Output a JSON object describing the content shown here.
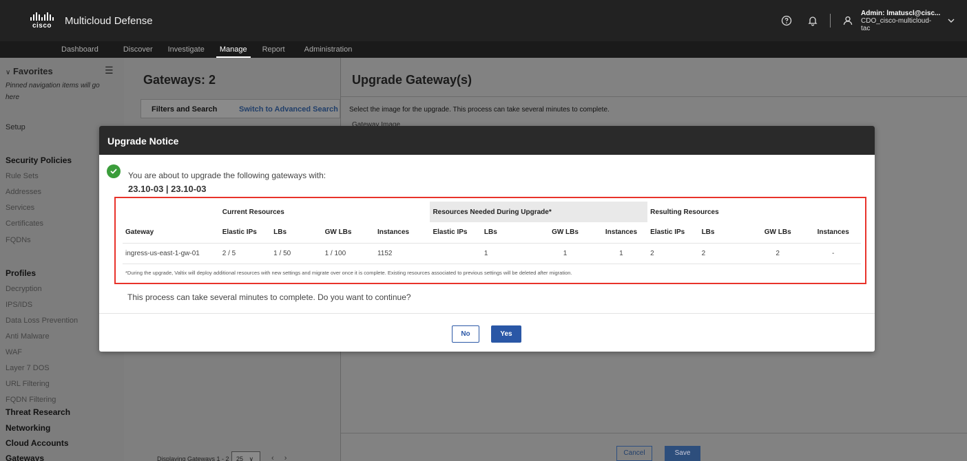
{
  "app": {
    "logo_text": "cisco",
    "title": "Multicloud Defense"
  },
  "user": {
    "line1": "Admin: lmatuscl@cisc...",
    "line2": "CDO_cisco-multicloud-",
    "line3": "tac"
  },
  "nav": {
    "items": [
      "Dashboard",
      "Discover",
      "Investigate",
      "Manage",
      "Report",
      "Administration"
    ],
    "active": "Manage"
  },
  "sidebar": {
    "favorites_label": "Favorites",
    "favorites_sub": "Pinned navigation items will go here",
    "setup": "Setup",
    "security_policies": "Security Policies",
    "policy_items": [
      "Rule Sets",
      "Addresses",
      "Services",
      "Certificates",
      "FQDNs"
    ],
    "profiles": "Profiles",
    "profile_items": [
      "Decryption",
      "IPS/IDS",
      "Data Loss Prevention",
      "Anti Malware",
      "WAF",
      "Layer 7 DOS",
      "URL Filtering",
      "FQDN Filtering"
    ],
    "threat_research": "Threat Research",
    "networking": "Networking",
    "cloud_accounts": "Cloud Accounts",
    "gateways": "Gateways"
  },
  "gateways_panel": {
    "title": "Gateways: 2",
    "filters_label": "Filters and Search",
    "switch_link": "Switch to Advanced Search",
    "displaying": "Displaying Gateways 1 - 2",
    "page_size": "25"
  },
  "upgrade_panel": {
    "title": "Upgrade Gateway(s)",
    "description": "Select the image for the upgrade. This process can take several minutes to complete.",
    "image_label": "Gateway Image",
    "cancel_label": "Cancel",
    "save_label": "Save"
  },
  "modal": {
    "title": "Upgrade Notice",
    "intro": "You are about to upgrade the following gateways with:",
    "version": "23.10-03 | 23.10-03",
    "groups": {
      "current": "Current Resources",
      "needed": "Resources Needed During Upgrade*",
      "resulting": "Resulting Resources"
    },
    "columns": [
      "Gateway",
      "Elastic IPs",
      "LBs",
      "GW LBs",
      "Instances",
      "Elastic IPs",
      "LBs",
      "GW LBs",
      "Instances",
      "Elastic IPs",
      "LBs",
      "GW LBs",
      "Instances"
    ],
    "rows": [
      [
        "ingress-us-east-1-gw-01",
        "2 / 5",
        "1 / 50",
        "1 / 100",
        "1152",
        "",
        "1",
        "1",
        "1",
        "2",
        "2",
        "2",
        "-"
      ]
    ],
    "footnote": "*During the upgrade, Valtix will deploy additional resources with new settings and migrate over once it is complete. Existing resources associated to previous settings will be deleted after migration.",
    "confirm": "This process can take several minutes to complete. Do you want to continue?",
    "no_label": "No",
    "yes_label": "Yes"
  },
  "colors": {
    "primary": "#2a57a6",
    "success": "#3b9d3b",
    "highlight_border": "#e8322a",
    "header_bg": "#2a2a2a"
  }
}
